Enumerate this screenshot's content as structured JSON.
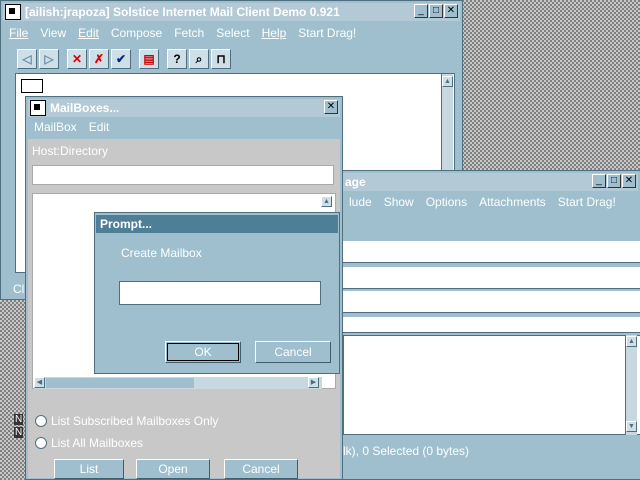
{
  "main_window": {
    "title": "[ailish:jrapoza] Solstice Internet Mail Client Demo 0.921",
    "menu": [
      "File",
      "View",
      "Edit",
      "Compose",
      "Fetch",
      "Select",
      "Help",
      "Start Drag!"
    ],
    "toolbar_icons": [
      "back-arrow-icon",
      "forward-arrow-icon",
      "delete-icon",
      "undelete-icon",
      "check-icon",
      "print-icon",
      "help-icon",
      "search-icon",
      "lock-icon"
    ],
    "status_fragment": "Cl"
  },
  "message_window": {
    "title_fragment": "age",
    "menu": [
      "lude",
      "Show",
      "Options",
      "Attachments",
      "Start Drag!"
    ],
    "status": "lk), 0 Selected (0 bytes)",
    "side_labels": [
      "N",
      "N"
    ]
  },
  "mailboxes_dialog": {
    "title": "MailBoxes...",
    "menu": [
      "MailBox",
      "Edit"
    ],
    "host_label": "Host:Directory",
    "host_value": "",
    "radio_subscribed": "List Subscribed Mailboxes Only",
    "radio_all": "List All Mailboxes",
    "list_button": "List",
    "open_button": "Open",
    "cancel_button": "Cancel"
  },
  "prompt_dialog": {
    "title": "Prompt...",
    "message": "Create Mailbox",
    "input_value": "",
    "ok_button": "OK",
    "cancel_button": "Cancel"
  },
  "colors": {
    "window_bg": "#9fbfcf",
    "active_title": "#4f7f97",
    "inactive_title": "#b3c9d6",
    "border": "#4f6f7f"
  }
}
